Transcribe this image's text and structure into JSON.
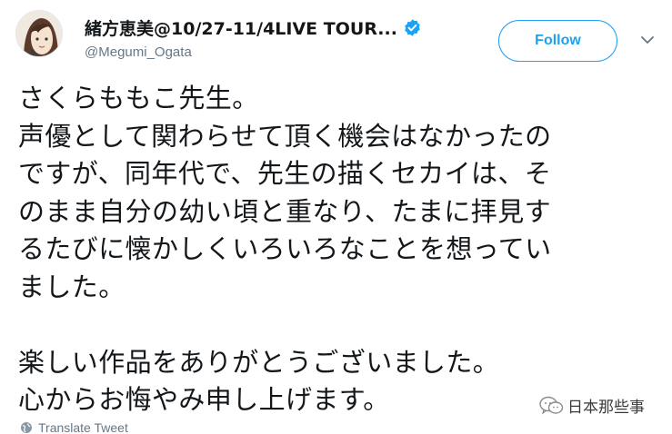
{
  "user": {
    "display_name": "緒方恵美@10/27-11/4LIVE TOUR...",
    "handle": "@Megumi_Ogata",
    "avatar_icon": "user-avatar",
    "verified_icon": "verified-badge-icon"
  },
  "actions": {
    "follow_label": "Follow",
    "menu_icon": "chevron-down-icon"
  },
  "tweet": {
    "lines": [
      "さくらももこ先生。",
      "声優として関わらせて頂く機会はなかったの",
      "ですが、同年代で、先生の描くセカイは、そ",
      "のまま自分の幼い頃と重なり、たまに拝見す",
      "るたびに懐かしくいろいろなことを想ってい",
      "ました。",
      "",
      "楽しい作品をありがとうございました。",
      "心からお悔やみ申し上げます。"
    ]
  },
  "footer": {
    "translate_label": "Translate Tweet",
    "translate_icon": "globe-icon"
  },
  "watermark": {
    "text": "日本那些事",
    "icon": "wechat-icon"
  },
  "colors": {
    "accent": "#1da1f2",
    "text": "#14171a",
    "secondary": "#657786"
  }
}
